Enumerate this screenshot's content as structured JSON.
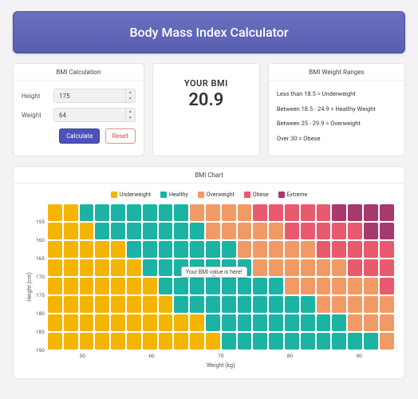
{
  "header": {
    "title": "Body Mass Index Calculator"
  },
  "calc": {
    "title": "BMI Calculation",
    "height_label": "Height",
    "height_value": "175",
    "weight_label": "Weight",
    "weight_value": "64",
    "calc_btn": "Calculate",
    "reset_btn": "Reset"
  },
  "result": {
    "label": "YOUR BMI",
    "value": "20.9"
  },
  "ranges": {
    "title": "BMI Weight Ranges",
    "items": [
      "Less than 18.5 = Underweight",
      "Between 18.5 - 24.9 = Healthy Weight",
      "Between 25 - 29.9 = Overweight",
      "Over 30 = Obese"
    ]
  },
  "chart": {
    "title": "BMI Chart",
    "legend": [
      "Underweight",
      "Healthy",
      "Overweight",
      "Obese",
      "Extreme"
    ],
    "yaxis": "Height (cm)",
    "xaxis": "Weight (kg)",
    "tooltip": "Your BMI value is here!"
  },
  "chart_data": {
    "type": "heatmap",
    "xlabel": "Weight (kg)",
    "ylabel": "Height (cm)",
    "x_range_start": 40,
    "x_range_step": 2.5,
    "y_range": [
      155,
      160,
      165,
      170,
      175,
      180,
      185,
      190
    ],
    "x_ticks": [
      50,
      60,
      70,
      80,
      90
    ],
    "cell_cols": 22,
    "cell_rows": 8,
    "thresholds": {
      "underweight_lt": 18.5,
      "healthy_lt": 25,
      "overweight_lt": 30,
      "obese_lt": 35
    },
    "marker": {
      "height_cm": 175,
      "weight_kg": 64,
      "bmi": 20.9
    },
    "series": [
      "Underweight",
      "Healthy",
      "Overweight",
      "Obese",
      "Extreme"
    ]
  }
}
